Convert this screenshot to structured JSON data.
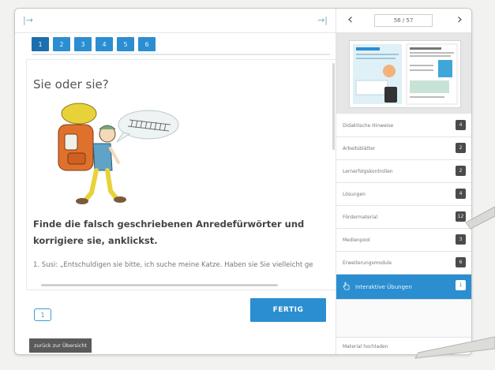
{
  "toolbar": {
    "expand_icon": "expand-icon",
    "collapse_icon": "collapse-icon"
  },
  "page_tabs": [
    "1",
    "2",
    "3",
    "4",
    "5",
    "6"
  ],
  "exercise": {
    "title": "Sie oder sie?",
    "instruction": "Finde die falsch geschriebenen Anredefürwörter und korrigiere sie, anklickst.",
    "sentence": "1. Susi: „Entschuldigen sie bitte, ich suche meine Katze. Haben sie Sie vielleicht ge",
    "counter": "1",
    "done_label": "FERTIG"
  },
  "back_label": "zurück zur Übersicht",
  "pager": {
    "page": "56 / 57"
  },
  "menu": [
    {
      "label": "Didaktische Hinweise",
      "count": "4"
    },
    {
      "label": "Arbeitsblätter",
      "count": "2"
    },
    {
      "label": "Lernerfolgskontrollen",
      "count": "2"
    },
    {
      "label": "Lösungen",
      "count": "4"
    },
    {
      "label": "Fördermaterial",
      "count": "12"
    },
    {
      "label": "Medienpool",
      "count": "3"
    },
    {
      "label": "Erweiterungsmodule",
      "count": "6"
    }
  ],
  "active_menu": {
    "label": "Interaktive Übungen",
    "count": "1"
  },
  "download_label": "Material hochladen",
  "colors": {
    "accent": "#2b8ed1",
    "dark_badge": "#4b4b4b"
  }
}
